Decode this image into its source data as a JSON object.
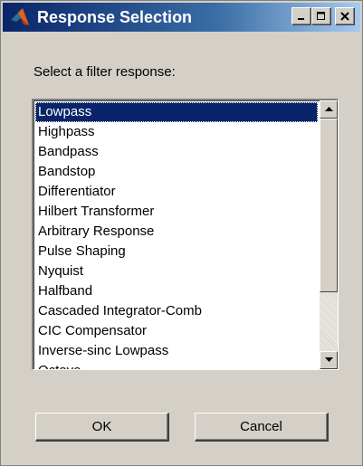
{
  "window": {
    "title": "Response Selection",
    "icon": "matlab-logo-icon",
    "buttons": [
      "minimize-icon",
      "maximize-icon",
      "close-icon"
    ],
    "titlebar_color": "#0a246a"
  },
  "prompt": "Select a filter response:",
  "list": {
    "items": [
      "Lowpass",
      "Highpass",
      "Bandpass",
      "Bandstop",
      "Differentiator",
      "Hilbert Transformer",
      "Arbitrary Response",
      "Pulse Shaping",
      "Nyquist",
      "Halfband",
      "Cascaded Integrator-Comb",
      "CIC Compensator",
      "Inverse-sinc Lowpass",
      "Octave"
    ],
    "selected": "Lowpass",
    "selection_color": "#0a246a"
  },
  "buttons": {
    "ok": "OK",
    "cancel": "Cancel"
  }
}
